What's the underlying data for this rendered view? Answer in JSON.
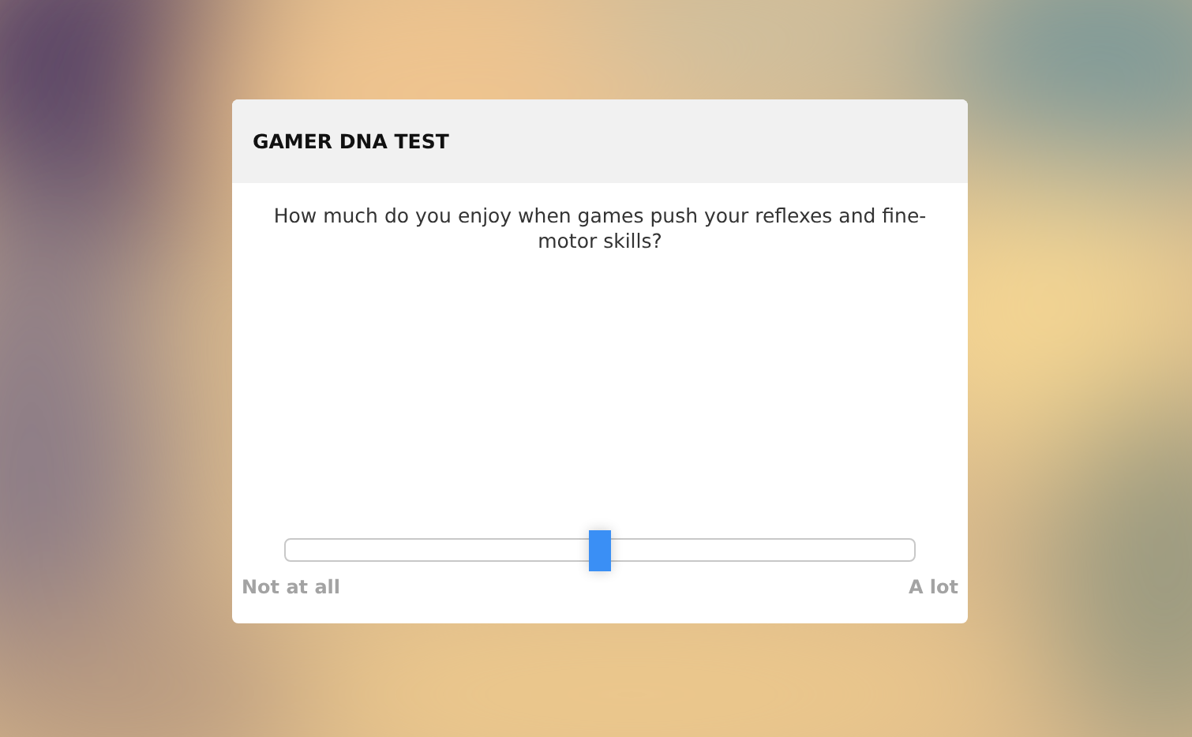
{
  "card": {
    "title": "GAMER DNA TEST",
    "question": "How much do you enjoy when games push your reflexes and fine-motor skills?",
    "slider": {
      "level": 0.5,
      "min_label": "Not at all",
      "max_label": "A lot"
    }
  }
}
